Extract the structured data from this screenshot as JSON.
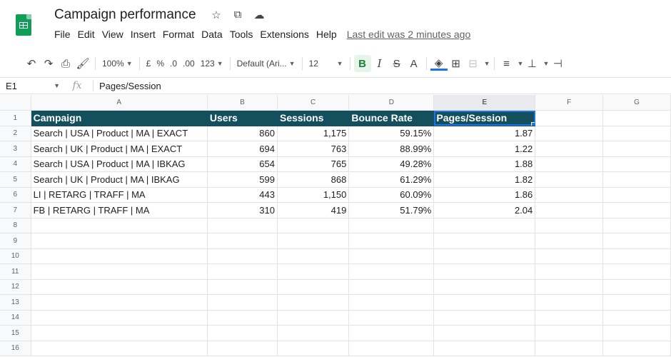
{
  "app": {
    "title": "Campaign performance",
    "star_icon": "☆",
    "folder_icon": "⧉",
    "cloud_icon": "☁"
  },
  "menu": {
    "items": [
      "File",
      "Edit",
      "View",
      "Insert",
      "Format",
      "Data",
      "Tools",
      "Extensions",
      "Help"
    ],
    "last_edit": "Last edit was 2 minutes ago"
  },
  "toolbar": {
    "zoom": "100%",
    "currency": "£",
    "percent": "%",
    "dec_decrease": ".0",
    "dec_increase": ".00",
    "more_formats": "123",
    "font": "Default (Ari...",
    "font_size": "12",
    "bold": "B",
    "italic": "I",
    "strike": "S",
    "text_color": "A"
  },
  "formula_bar": {
    "cell_ref": "E1",
    "fx": "fx",
    "value": "Pages/Session"
  },
  "columns": [
    "A",
    "B",
    "C",
    "D",
    "E",
    "F",
    "G"
  ],
  "selected_column": "E",
  "table": {
    "headers": [
      "Campaign",
      "Users",
      "Sessions",
      "Bounce Rate",
      "Pages/Session"
    ],
    "rows": [
      [
        "Search | USA | Product | MA | EXACT",
        "860",
        "1,175",
        "59.15%",
        "1.87"
      ],
      [
        "Search | UK | Product | MA | EXACT",
        "694",
        "763",
        "88.99%",
        "1.22"
      ],
      [
        "Search | USA | Product | MA | IBKAG",
        "654",
        "765",
        "49.28%",
        "1.88"
      ],
      [
        "Search | UK | Product | MA | IBKAG",
        "599",
        "868",
        "61.29%",
        "1.82"
      ],
      [
        "LI | RETARG | TRAFF | MA",
        "443",
        "1,150",
        "60.09%",
        "1.86"
      ],
      [
        "FB | RETARG | TRAFF | MA",
        "310",
        "419",
        "51.79%",
        "2.04"
      ]
    ]
  },
  "row_numbers": [
    "1",
    "2",
    "3",
    "4",
    "5",
    "6",
    "7",
    "8",
    "9",
    "10",
    "11",
    "12",
    "13",
    "14",
    "15",
    "16"
  ],
  "colors": {
    "header_fill": "#134f5c",
    "header_text": "#ffffff",
    "selection": "#1a73e8",
    "logo": "#0f9d58"
  }
}
